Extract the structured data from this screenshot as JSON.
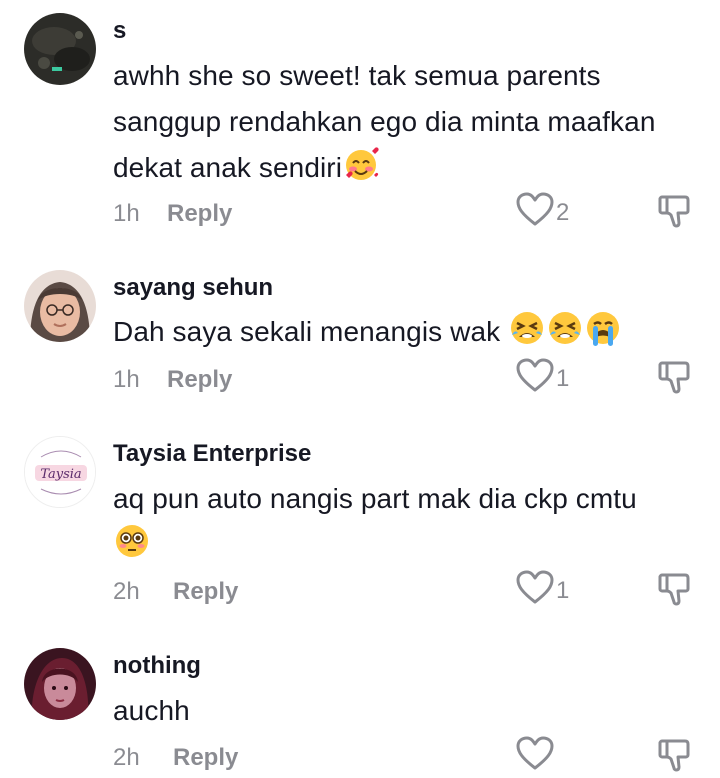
{
  "comments": [
    {
      "username": "s",
      "text": "awhh she so sweet! tak semua parents sanggup rendahkan ego dia minta maafkan dekat anak sendiri",
      "emoji": "smiling-face-with-hearts",
      "time": "1h",
      "reply_label": "Reply",
      "likes": "2"
    },
    {
      "username": "sayang sehun",
      "text": "Dah saya sekali menangis wak ",
      "emoji": "tired-face tired-face loudly-crying-face",
      "time": "1h",
      "reply_label": "Reply",
      "likes": "1"
    },
    {
      "username": "Taysia Enterprise",
      "text": "aq pun auto nangis part mak dia ckp cmtu",
      "emoji": "flushed-face",
      "avatar_logo_text": "Taysia",
      "time": "2h",
      "reply_label": "Reply",
      "likes": "1"
    },
    {
      "username": "nothing",
      "text": "auchh",
      "time": "2h",
      "reply_label": "Reply",
      "likes": ""
    }
  ],
  "colors": {
    "text_primary": "#161823",
    "text_secondary": "rgba(22,24,35,0.5)",
    "icon": "#8a8b91"
  }
}
